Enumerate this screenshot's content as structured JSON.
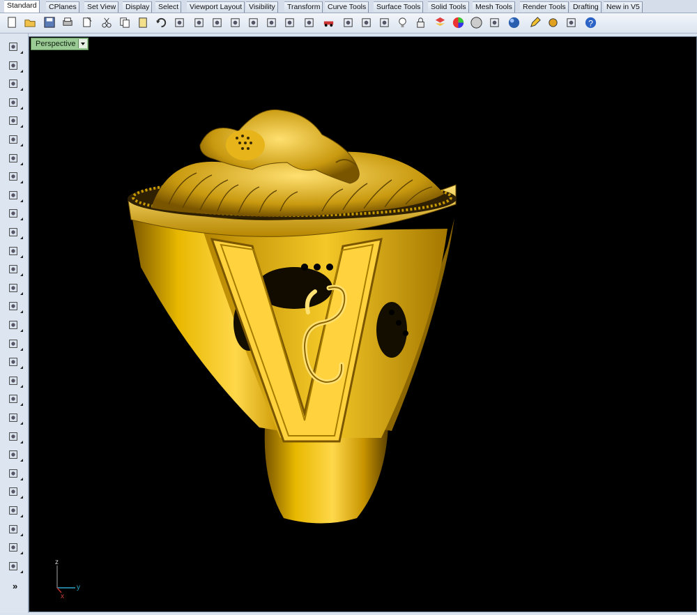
{
  "tabs": [
    {
      "label": "Standard",
      "active": true
    },
    {
      "label": "CPlanes"
    },
    {
      "label": "Set View"
    },
    {
      "label": "Display"
    },
    {
      "label": "Select"
    },
    {
      "label": "Viewport Layout"
    },
    {
      "label": "Visibility"
    },
    {
      "label": "Transform"
    },
    {
      "label": "Curve Tools"
    },
    {
      "label": "Surface Tools"
    },
    {
      "label": "Solid Tools"
    },
    {
      "label": "Mesh Tools"
    },
    {
      "label": "Render Tools"
    },
    {
      "label": "Drafting"
    },
    {
      "label": "New in V5"
    }
  ],
  "toolbar_icons": [
    "new-icon",
    "open-icon",
    "save-icon",
    "print-icon",
    "import-icon",
    "cut-icon",
    "copy-icon",
    "paste-icon",
    "undo-icon",
    "pan-hand-icon",
    "move-view-icon",
    "zoom-icon",
    "zoom-window-icon",
    "zoom-extents-icon",
    "zoom-selected-icon",
    "rotate-view-icon",
    "four-viewports-icon",
    "car-icon",
    "camera-icon",
    "circle-arrow-icon",
    "sparkle-icon",
    "light-bulb-icon",
    "lock-icon",
    "layer-icon",
    "color-wheel-icon",
    "sphere-icon",
    "sphere-grid-icon",
    "render-icon",
    "pencil-icon",
    "gear-icon",
    "dimension-icon",
    "help-icon"
  ],
  "left_tools": [
    "select-icon",
    "point-icon",
    "polyline-icon",
    "curve-icon",
    "circle-icon",
    "ellipse-icon",
    "polygon-icon",
    "rectangle-icon",
    "hexagon-icon",
    "fillet-curve-icon",
    "surface-grid-icon",
    "extrude-icon",
    "box-icon",
    "spheres-icon",
    "cylinder-icon",
    "surface-patch-icon",
    "gear-puzzle-icon",
    "explode-icon",
    "join-icon",
    "split-icon",
    "boolean-icon",
    "points-cluster-icon",
    "rotate-icon",
    "arc-icon",
    "text-icon",
    "transform-icon",
    "array-icon",
    "dimension-tool-icon",
    "box-render-icon"
  ],
  "more_glyph": "»",
  "viewport": {
    "label": "Perspective",
    "axis": {
      "x": "x",
      "y": "y",
      "z": "z"
    }
  },
  "colors": {
    "gold_light": "#ffe060",
    "gold_mid": "#d9a800",
    "gold_dark": "#6b4d00",
    "background": "#000000"
  }
}
